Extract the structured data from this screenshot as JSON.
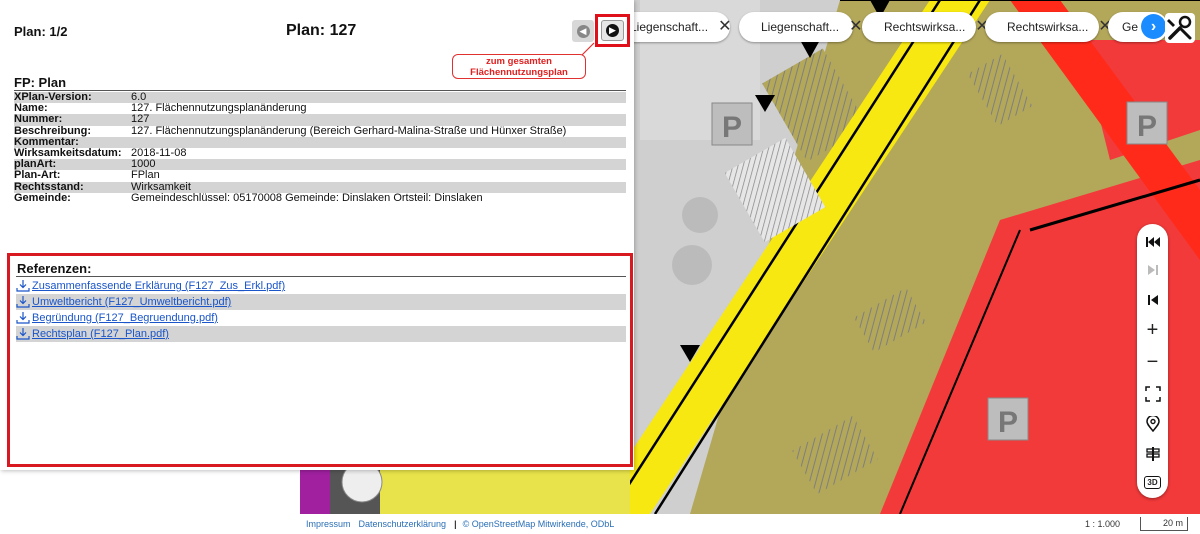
{
  "panel": {
    "plan_count": "Plan: 1/2",
    "plan_title": "Plan: 127",
    "callout_line1": "zum gesamten",
    "callout_line2": "Flächennutzungsplan",
    "section_title": "FP: Plan",
    "properties": [
      {
        "key": "XPlan-Version:",
        "value": "6.0"
      },
      {
        "key": "Name:",
        "value": "127. Flächennutzungsplanänderung"
      },
      {
        "key": "Nummer:",
        "value": "127"
      },
      {
        "key": "Beschreibung:",
        "value": "127. Flächennutzungsplanänderung (Bereich Gerhard-Malina-Straße und Hünxer Straße)"
      },
      {
        "key": "Kommentar:",
        "value": ""
      },
      {
        "key": "Wirksamkeitsdatum:",
        "value": "2018-11-08"
      },
      {
        "key": "planArt:",
        "value": "1000"
      },
      {
        "key": "Plan-Art:",
        "value": "FPlan"
      },
      {
        "key": "Rechtsstand:",
        "value": "Wirksamkeit"
      },
      {
        "key": "Gemeinde:",
        "value": "Gemeindeschlüssel: 05170008 Gemeinde: Dinslaken Ortsteil: Dinslaken"
      }
    ],
    "refs_title": "Referenzen:",
    "references": [
      "Zusammenfassende Erklärung (F127_Zus_Erkl.pdf)",
      "Umweltbericht (F127_Umweltbericht.pdf)",
      "Begründung (F127_Begruendung.pdf)",
      "Rechtsplan (F127_Plan.pdf)"
    ]
  },
  "chips": [
    {
      "label": "Liegenschaft..."
    },
    {
      "label": "Liegenschaft..."
    },
    {
      "label": "Rechtswirksa..."
    },
    {
      "label": "Rechtswirksa..."
    },
    {
      "label": "Ge"
    }
  ],
  "footer": {
    "impressum": "Impressum",
    "datenschutz": "Datenschutzerklärung",
    "separator": "|",
    "osm": "© OpenStreetMap Mitwirkende, ODbL",
    "scale": "1 : 1.000",
    "scale_bar": "20 m"
  },
  "controls": {
    "three_d": "3D"
  },
  "colors": {
    "highlight": "#d81920",
    "link": "#1a55c9",
    "map_red": "#f23a3a",
    "map_olive": "#b3a75a",
    "map_yellow": "#f7e811",
    "map_gray": "#cfcfcf"
  }
}
